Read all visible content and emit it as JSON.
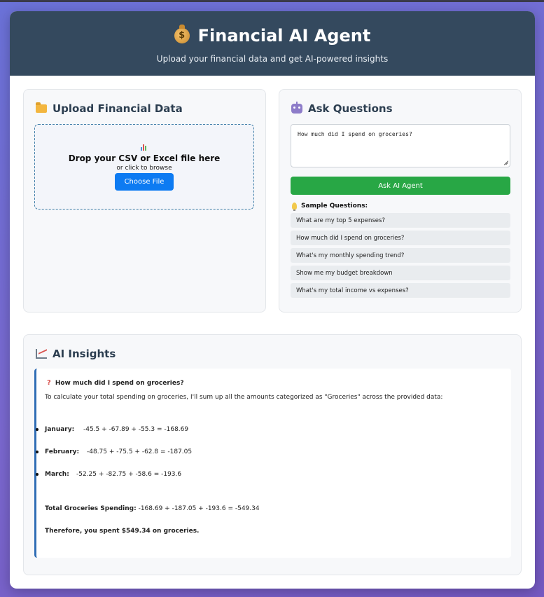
{
  "header": {
    "title": "Financial AI Agent",
    "subtitle": "Upload your financial data and get AI-powered insights",
    "icon": "money-bag-icon"
  },
  "upload": {
    "title": "Upload Financial Data",
    "icon": "folder-icon",
    "drop_title": "Drop your CSV or Excel file here",
    "drop_sub": "or click to browse",
    "choose_label": "Choose File"
  },
  "ask": {
    "title": "Ask Questions",
    "icon": "robot-icon",
    "question_value": "How much did I spend on groceries?",
    "ask_label": "Ask AI Agent",
    "sample_heading": "Sample Questions:",
    "samples": [
      "What are my top 5 expenses?",
      "How much did I spend on groceries?",
      "What's my monthly spending trend?",
      "Show me my budget breakdown",
      "What's my total income vs expenses?"
    ]
  },
  "insights": {
    "title": "AI Insights",
    "icon": "chart-icon",
    "question": "How much did I spend on groceries?",
    "intro": "To calculate your total spending on groceries, I'll sum up all the amounts categorized as \"Groceries\" across the provided data:",
    "months": [
      {
        "label": "January:",
        "calc": "-45.5 + -67.89 + -55.3 = -168.69"
      },
      {
        "label": "February:",
        "calc": "-48.75 + -75.5 + -62.8 = -187.05"
      },
      {
        "label": "March:",
        "calc": "-52.25 + -82.75 + -58.6 = -193.6"
      }
    ],
    "total_label": "Total Groceries Spending:",
    "total_calc": "-168.69 + -187.05 + -193.6 = -549.34",
    "conclusion": "Therefore, you spent $549.34 on groceries."
  },
  "colors": {
    "header_bg": "#34495e",
    "primary_button": "#0d7bf2",
    "ask_button": "#28a745",
    "insight_accent": "#2f6db5"
  }
}
